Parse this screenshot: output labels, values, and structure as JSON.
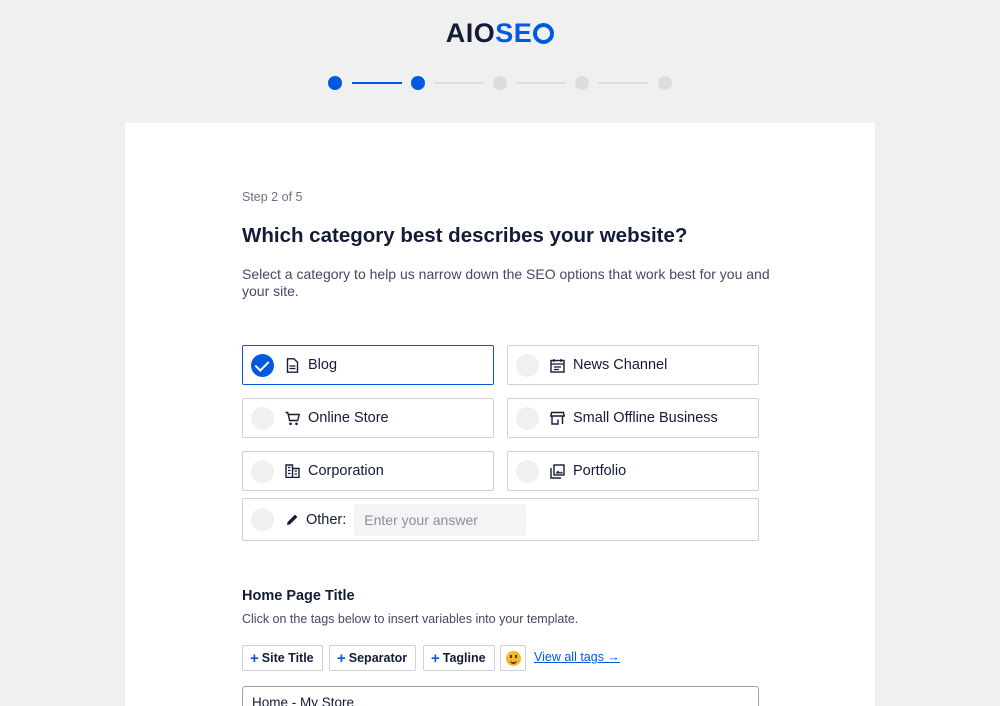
{
  "logo": {
    "part1": "AIO",
    "part2": "SE"
  },
  "stepper": {
    "total": 5,
    "current": 2
  },
  "step_label": "Step 2 of 5",
  "heading": "Which category best describes your website?",
  "description": "Select a category to help us narrow down the SEO options that work best for you and your site.",
  "categories": [
    {
      "label": "Blog",
      "icon": "document-icon",
      "selected": true
    },
    {
      "label": "News Channel",
      "icon": "calendar-icon",
      "selected": false
    },
    {
      "label": "Online Store",
      "icon": "cart-icon",
      "selected": false
    },
    {
      "label": "Small Offline Business",
      "icon": "store-icon",
      "selected": false
    },
    {
      "label": "Corporation",
      "icon": "building-icon",
      "selected": false
    },
    {
      "label": "Portfolio",
      "icon": "gallery-icon",
      "selected": false
    }
  ],
  "other": {
    "label": "Other:",
    "placeholder": "Enter your answer",
    "value": ""
  },
  "home_page": {
    "title": "Home Page Title",
    "description": "Click on the tags below to insert variables into your template.",
    "tags": [
      "Site Title",
      "Separator",
      "Tagline"
    ],
    "view_all": "View all tags →",
    "input_value": "Home - My Store"
  },
  "colors": {
    "accent": "#005ae0",
    "text": "#141b38",
    "background": "#f0f0f1"
  }
}
